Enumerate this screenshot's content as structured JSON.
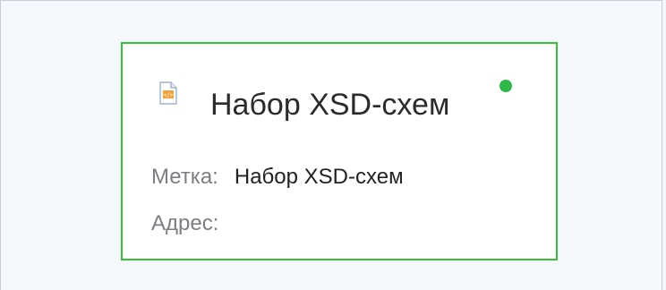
{
  "node": {
    "title": "Набор XSD-схем",
    "icon": "xsd-file-icon",
    "status": "active",
    "status_color": "#2fb84a",
    "border_color": "#35c335",
    "properties": {
      "label_key": "Метка:",
      "label_value": "Набор XSD-схем",
      "address_key": "Адрес:",
      "address_value": ""
    }
  }
}
